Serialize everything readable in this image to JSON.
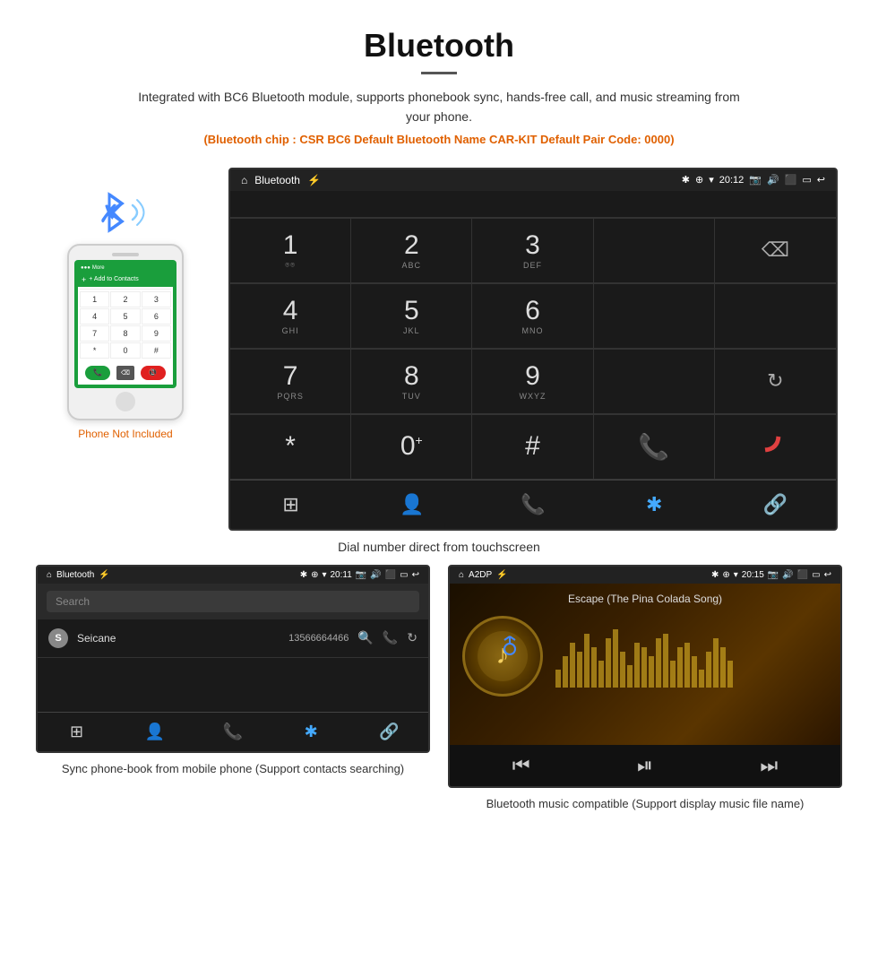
{
  "header": {
    "title": "Bluetooth",
    "description": "Integrated with BC6 Bluetooth module, supports phonebook sync, hands-free call, and music streaming from your phone.",
    "specs": "(Bluetooth chip : CSR BC6    Default Bluetooth Name CAR-KIT    Default Pair Code: 0000)"
  },
  "phone_mockup": {
    "not_included_label": "Phone Not Included",
    "screen_header": "More",
    "add_contact": "+ Add to Contacts",
    "keys": [
      "1",
      "2",
      "3",
      "4",
      "5",
      "6",
      "7",
      "8",
      "9",
      "*",
      "0",
      "#"
    ]
  },
  "main_screen": {
    "statusbar": {
      "app_name": "Bluetooth",
      "time": "20:12"
    },
    "dialpad": {
      "keys": [
        {
          "num": "1",
          "sub": ""
        },
        {
          "num": "2",
          "sub": "ABC"
        },
        {
          "num": "3",
          "sub": "DEF"
        },
        {
          "num": "",
          "sub": ""
        },
        {
          "num": "",
          "sub": "backspace"
        },
        {
          "num": "4",
          "sub": "GHI"
        },
        {
          "num": "5",
          "sub": "JKL"
        },
        {
          "num": "6",
          "sub": "MNO"
        },
        {
          "num": "",
          "sub": ""
        },
        {
          "num": "",
          "sub": ""
        },
        {
          "num": "7",
          "sub": "PQRS"
        },
        {
          "num": "8",
          "sub": "TUV"
        },
        {
          "num": "9",
          "sub": "WXYZ"
        },
        {
          "num": "",
          "sub": ""
        },
        {
          "num": "",
          "sub": "refresh"
        },
        {
          "num": "*",
          "sub": ""
        },
        {
          "num": "0+",
          "sub": ""
        },
        {
          "num": "#",
          "sub": ""
        },
        {
          "num": "",
          "sub": "call-green"
        },
        {
          "num": "",
          "sub": "call-red"
        }
      ]
    },
    "toolbar": {
      "icons": [
        "dialpad",
        "person",
        "phone",
        "bluetooth",
        "link"
      ]
    }
  },
  "dial_caption": "Dial number direct from touchscreen",
  "phonebook_screen": {
    "statusbar_app": "Bluetooth",
    "statusbar_time": "20:11",
    "search_placeholder": "Search",
    "contacts": [
      {
        "letter": "S",
        "name": "Seicane",
        "number": "13566664466"
      }
    ],
    "toolbar_icons": [
      "dialpad",
      "person",
      "phone",
      "bluetooth",
      "link"
    ]
  },
  "music_screen": {
    "statusbar_app": "A2DP",
    "statusbar_time": "20:15",
    "song_title": "Escape (The Pina Colada Song)",
    "controls": [
      "prev",
      "play-pause",
      "next"
    ]
  },
  "bottom_captions": {
    "phonebook": "Sync phone-book from mobile phone\n(Support contacts searching)",
    "music": "Bluetooth music compatible\n(Support display music file name)"
  }
}
